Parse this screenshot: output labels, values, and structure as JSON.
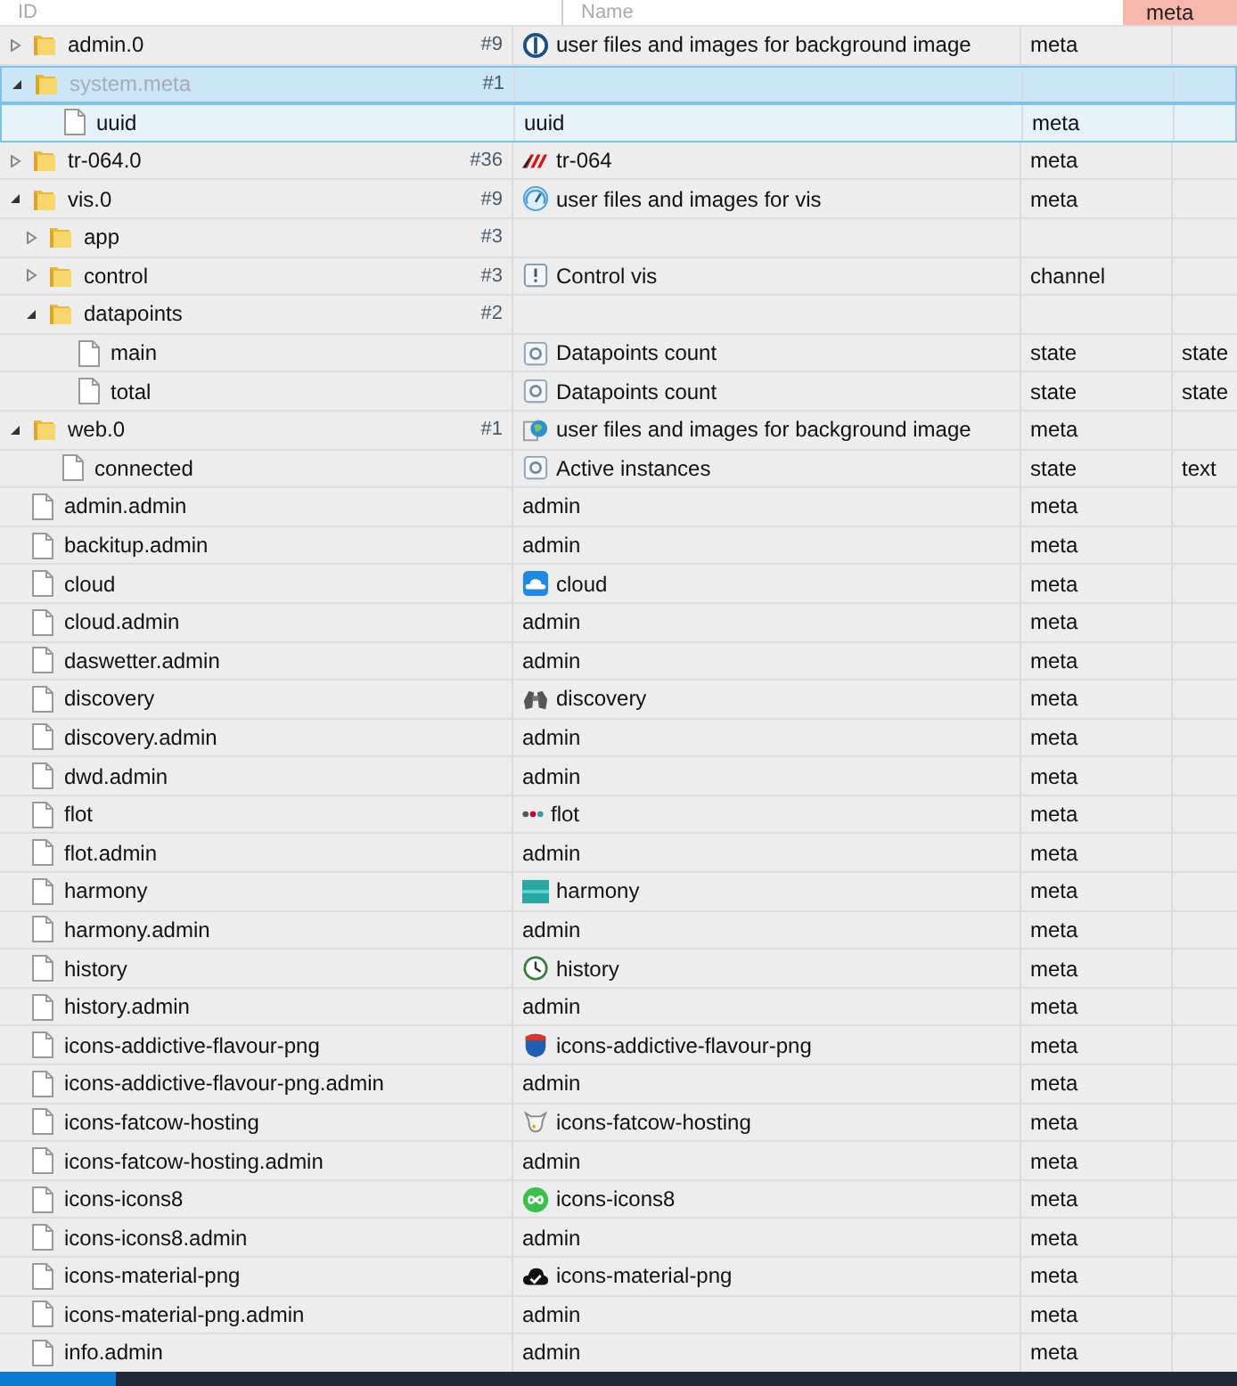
{
  "filters": {
    "id_placeholder": "ID",
    "name_placeholder": "Name",
    "type_value": "meta"
  },
  "tree": [
    {
      "kind": "folder",
      "id": "admin.0",
      "count": "#9",
      "name_icon": {
        "kind": "power"
      },
      "name": "user files and images for background image",
      "type": "meta",
      "expanded": false,
      "selected": false,
      "hovered": false
    },
    {
      "kind": "folder",
      "id": "system.meta",
      "count": "#1",
      "expanded": true,
      "selected": true,
      "hovered": false,
      "children": [
        {
          "kind": "file",
          "id": "uuid",
          "name": "uuid",
          "type": "meta",
          "selected": false,
          "hovered": true
        }
      ]
    },
    {
      "kind": "folder",
      "id": "tr-064.0",
      "count": "#36",
      "name_icon": {
        "kind": "stripes"
      },
      "name": "tr-064",
      "type": "meta",
      "expanded": false,
      "selected": false,
      "hovered": false
    },
    {
      "kind": "folder",
      "id": "vis.0",
      "count": "#9",
      "name_icon": {
        "kind": "gauge"
      },
      "name": "user files and images for vis",
      "type": "meta",
      "expanded": true,
      "selected": false,
      "hovered": false,
      "children": [
        {
          "kind": "folder",
          "id": "app",
          "count": "#3",
          "expanded": false,
          "selected": false,
          "hovered": false
        },
        {
          "kind": "folder",
          "id": "control",
          "count": "#3",
          "name_icon": {
            "kind": "info"
          },
          "name": "Control vis",
          "type": "channel",
          "expanded": false,
          "selected": false,
          "hovered": false
        },
        {
          "kind": "folder",
          "id": "datapoints",
          "count": "#2",
          "expanded": true,
          "selected": false,
          "hovered": false,
          "children": [
            {
              "kind": "file",
              "id": "main",
              "name_icon": {
                "kind": "state"
              },
              "name": "Datapoints count",
              "type": "state",
              "role": "state",
              "selected": false,
              "hovered": false
            },
            {
              "kind": "file",
              "id": "total",
              "name_icon": {
                "kind": "state"
              },
              "name": "Datapoints count",
              "type": "state",
              "role": "state",
              "selected": false,
              "hovered": false
            }
          ]
        }
      ]
    },
    {
      "kind": "folder",
      "id": "web.0",
      "count": "#1",
      "name_icon": {
        "kind": "globe"
      },
      "name": "user files and images for background image",
      "type": "meta",
      "expanded": true,
      "selected": false,
      "hovered": false,
      "children": [
        {
          "kind": "file",
          "id": "connected",
          "name_icon": {
            "kind": "state"
          },
          "name": "Active instances",
          "type": "state",
          "role": "text",
          "selected": false,
          "hovered": false
        }
      ]
    },
    {
      "kind": "file",
      "id": "admin.admin",
      "name": "admin",
      "type": "meta",
      "selected": false,
      "hovered": false
    },
    {
      "kind": "file",
      "id": "backitup.admin",
      "name": "admin",
      "type": "meta",
      "selected": false,
      "hovered": false
    },
    {
      "kind": "file",
      "id": "cloud",
      "name_icon": {
        "kind": "cloud"
      },
      "name": "cloud",
      "type": "meta",
      "selected": false,
      "hovered": false
    },
    {
      "kind": "file",
      "id": "cloud.admin",
      "name": "admin",
      "type": "meta",
      "selected": false,
      "hovered": false
    },
    {
      "kind": "file",
      "id": "daswetter.admin",
      "name": "admin",
      "type": "meta",
      "selected": false,
      "hovered": false
    },
    {
      "kind": "file",
      "id": "discovery",
      "name_icon": {
        "kind": "binoculars"
      },
      "name": "discovery",
      "type": "meta",
      "selected": false,
      "hovered": false
    },
    {
      "kind": "file",
      "id": "discovery.admin",
      "name": "admin",
      "type": "meta",
      "selected": false,
      "hovered": false
    },
    {
      "kind": "file",
      "id": "dwd.admin",
      "name": "admin",
      "type": "meta",
      "selected": false,
      "hovered": false
    },
    {
      "kind": "file",
      "id": "flot",
      "name_icon": {
        "kind": "dots"
      },
      "name": "flot",
      "type": "meta",
      "selected": false,
      "hovered": false
    },
    {
      "kind": "file",
      "id": "flot.admin",
      "name": "admin",
      "type": "meta",
      "selected": false,
      "hovered": false
    },
    {
      "kind": "file",
      "id": "harmony",
      "name_icon": {
        "kind": "tile"
      },
      "name": "harmony",
      "type": "meta",
      "selected": false,
      "hovered": false
    },
    {
      "kind": "file",
      "id": "harmony.admin",
      "name": "admin",
      "type": "meta",
      "selected": false,
      "hovered": false
    },
    {
      "kind": "file",
      "id": "history",
      "name_icon": {
        "kind": "clock"
      },
      "name": "history",
      "type": "meta",
      "selected": false,
      "hovered": false
    },
    {
      "kind": "file",
      "id": "history.admin",
      "name": "admin",
      "type": "meta",
      "selected": false,
      "hovered": false
    },
    {
      "kind": "file",
      "id": "icons-addictive-flavour-png",
      "name_icon": {
        "kind": "shield"
      },
      "name": "icons-addictive-flavour-png",
      "type": "meta",
      "selected": false,
      "hovered": false
    },
    {
      "kind": "file",
      "id": "icons-addictive-flavour-png.admin",
      "name": "admin",
      "type": "meta",
      "selected": false,
      "hovered": false
    },
    {
      "kind": "file",
      "id": "icons-fatcow-hosting",
      "name_icon": {
        "kind": "cowhead"
      },
      "name": "icons-fatcow-hosting",
      "type": "meta",
      "selected": false,
      "hovered": false
    },
    {
      "kind": "file",
      "id": "icons-fatcow-hosting.admin",
      "name": "admin",
      "type": "meta",
      "selected": false,
      "hovered": false
    },
    {
      "kind": "file",
      "id": "icons-icons8",
      "name_icon": {
        "kind": "infinity"
      },
      "name": "icons-icons8",
      "type": "meta",
      "selected": false,
      "hovered": false
    },
    {
      "kind": "file",
      "id": "icons-icons8.admin",
      "name": "admin",
      "type": "meta",
      "selected": false,
      "hovered": false
    },
    {
      "kind": "file",
      "id": "icons-material-png",
      "name_icon": {
        "kind": "cloudcheck"
      },
      "name": "icons-material-png",
      "type": "meta",
      "selected": false,
      "hovered": false
    },
    {
      "kind": "file",
      "id": "icons-material-png.admin",
      "name": "admin",
      "type": "meta",
      "selected": false,
      "hovered": false
    },
    {
      "kind": "file",
      "id": "info.admin",
      "name": "admin",
      "type": "meta",
      "selected": false,
      "hovered": false
    }
  ]
}
